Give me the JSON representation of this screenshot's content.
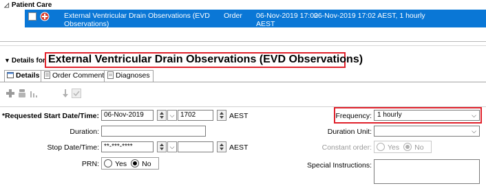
{
  "patient_care": {
    "section_label": "Patient Care",
    "order": {
      "name": "External Ventricular Drain Observations (EVD",
      "name_line2": "Observations)",
      "type": "Order",
      "start": "06-Nov-2019 17:02",
      "start_tz": "AEST",
      "details": "06-Nov-2019 17:02 AEST, 1 hourly"
    }
  },
  "details": {
    "label": "Details for",
    "title": "External Ventricular Drain Observations (EVD Observations)"
  },
  "tabs": [
    "Details",
    "Order Comments",
    "Diagnoses"
  ],
  "form": {
    "requested_start_label": "*Requested Start Date/Time:",
    "requested_start_date": "06-Nov-2019",
    "requested_start_time": "1702",
    "tz": "AEST",
    "duration_label": "Duration:",
    "duration_value": "",
    "stop_label": "Stop Date/Time:",
    "stop_date": "**-***-****",
    "stop_time": "",
    "prn_label": "PRN:",
    "prn_yes": "Yes",
    "prn_no": "No",
    "frequency_label": "Frequency:",
    "frequency_value": "1 hourly",
    "duration_unit_label": "Duration Unit:",
    "duration_unit_value": "",
    "constant_order_label": "Constant order:",
    "constant_yes": "Yes",
    "constant_no": "No",
    "special_instructions_label": "Special Instructions:"
  },
  "colors": {
    "selection": "#0a77d6",
    "highlight_box": "#e0202a"
  }
}
